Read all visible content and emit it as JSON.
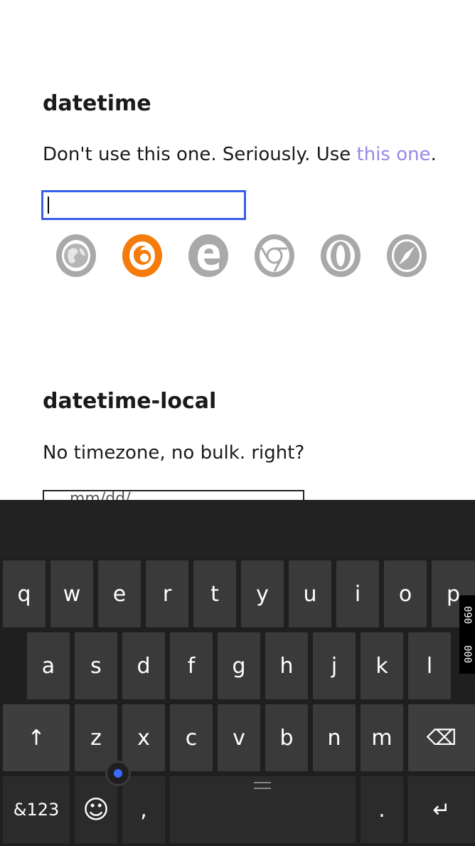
{
  "section1": {
    "heading": "datetime",
    "desc_prefix": "Don't use this one. Seriously. Use ",
    "desc_link": "this one",
    "desc_suffix": "."
  },
  "section2": {
    "heading": "datetime-local",
    "desc": "No timezone, no bulk. right?",
    "input_partial": "mm/dd/"
  },
  "browsers": [
    "globe-icon",
    "firefox-icon",
    "edge-icon",
    "chrome-icon",
    "opera-icon",
    "safari-icon"
  ],
  "colors": {
    "accent": "#3a5fe8",
    "link": "#9b87e8",
    "firefox": "#f57b0a",
    "grey_icon": "#a9a9a9",
    "keyboard_bg": "#1f1f1f",
    "key_bg": "#3a3a3a"
  },
  "keyboard": {
    "row1": [
      "q",
      "w",
      "e",
      "r",
      "t",
      "y",
      "u",
      "i",
      "o",
      "p"
    ],
    "row2": [
      "a",
      "s",
      "d",
      "f",
      "g",
      "h",
      "j",
      "k",
      "l"
    ],
    "row3": [
      "z",
      "x",
      "c",
      "v",
      "b",
      "n",
      "m"
    ],
    "shift": "↑",
    "backspace": "⌫",
    "symbols": "&123",
    "emoji": "☺",
    "comma": ",",
    "period": ".",
    "enter": "↵",
    "side_tag": [
      "090",
      "000"
    ]
  }
}
